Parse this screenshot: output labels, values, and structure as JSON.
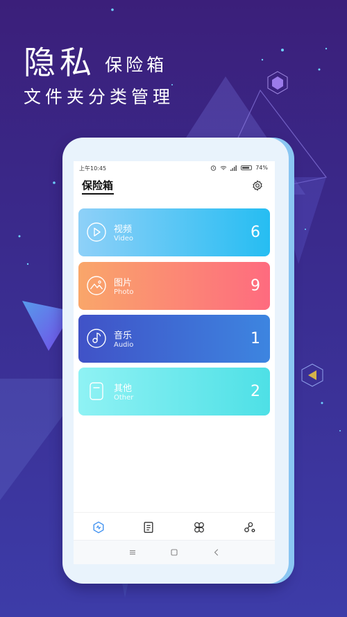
{
  "promo": {
    "title_big": "隐私",
    "title_mid": "保险箱",
    "subtitle": "文件夹分类管理"
  },
  "status_bar": {
    "time": "上午10:45",
    "battery": "74%"
  },
  "header": {
    "title": "保险箱",
    "settings_icon": "gear-icon"
  },
  "categories": [
    {
      "name": "视频",
      "en": "Video",
      "count": "6",
      "icon": "play-icon",
      "colors": [
        "#8ed0f8",
        "#26bdf2"
      ]
    },
    {
      "name": "图片",
      "en": "Photo",
      "count": "9",
      "icon": "image-icon",
      "colors": [
        "#f9a66a",
        "#fe6b7f"
      ]
    },
    {
      "name": "音乐",
      "en": "Audio",
      "count": "1",
      "icon": "music-disc-icon",
      "colors": [
        "#4052c7",
        "#3d85e0"
      ]
    },
    {
      "name": "其他",
      "en": "Other",
      "count": "2",
      "icon": "document-icon",
      "colors": [
        "#8ff2f4",
        "#4ee0e6"
      ]
    }
  ],
  "tabbar": {
    "items": [
      "vault-icon",
      "notes-icon",
      "apps-icon",
      "share-icon"
    ],
    "active_color": "#3a8ef0"
  },
  "system_nav": [
    "menu-icon",
    "home-icon",
    "back-icon"
  ]
}
